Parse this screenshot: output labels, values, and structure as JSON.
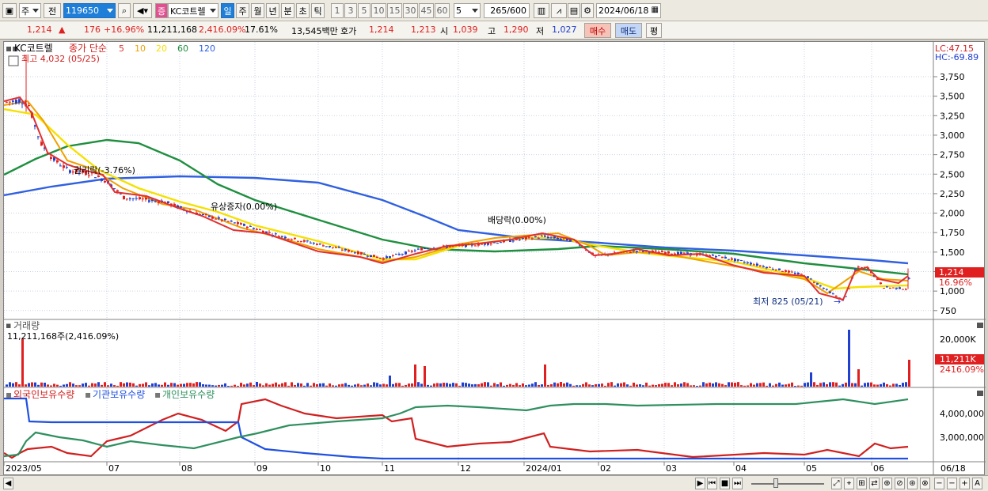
{
  "toolbar": {
    "type_selector": "주",
    "prev_label": "전",
    "code_value": "119650",
    "stock_badge": "증",
    "stock_name": "KC코트렐",
    "period_tabs": [
      "일",
      "주",
      "월",
      "년",
      "분",
      "초",
      "틱"
    ],
    "active_period": "일",
    "interval_buttons": [
      "1",
      "3",
      "5",
      "10",
      "15",
      "30",
      "45",
      "60"
    ],
    "interval_value": "5",
    "count_value": "265",
    "count_max": "/600",
    "date_value": "2024/06/18"
  },
  "quote": {
    "price": "1,214",
    "change": "176",
    "change_pct": "+16.96%",
    "volume": "11,211,168",
    "volume_pct": "2,416.09%",
    "turnover_rate": "17.61%",
    "amount": "13,545백만",
    "ask_label": "호가",
    "ask_price": "1,214",
    "bid_price": "1,213",
    "open_label": "시",
    "open": "1,039",
    "high_label": "고",
    "high": "1,290",
    "low_label": "저",
    "low": "1,027",
    "buy_button": "매수",
    "sell_button": "매도",
    "eval_button": "평"
  },
  "price_panel": {
    "stock_name": "KC코트렐",
    "legend_title": "종가 단순",
    "ma_periods": [
      "5",
      "10",
      "20",
      "60",
      "120"
    ],
    "ma_colors": [
      "#e03030",
      "#f0a000",
      "#f5e000",
      "#1f8f3f",
      "#3060e0"
    ],
    "max_label": "최고 4,032 (05/25)",
    "min_label": "최저 825 (05/21)",
    "lc_label": "LC:47.15",
    "hc_label": "HC:-69.89",
    "current_price": "1,214",
    "current_pct": "16.96%",
    "events": [
      "권리락(-3.76%)",
      "유상증자(0.00%)",
      "배당락(0.00%)"
    ],
    "y_ticks": [
      "3,750",
      "3,500",
      "3,250",
      "3,000",
      "2,750",
      "2,500",
      "2,250",
      "2,000",
      "1,750",
      "1,500",
      "1,250",
      "1,000",
      "750"
    ]
  },
  "volume_panel": {
    "title": "거래량",
    "info": "11,211,168주(2,416.09%)",
    "y_tick": "20,000K",
    "current_vol": "11,211K",
    "current_pct": "2416.09%"
  },
  "holding_panel": {
    "series": [
      "외국인보유수량",
      "기관보유수량",
      "개인보유수량"
    ],
    "series_colors": [
      "#d02020",
      "#2050e0",
      "#2f8f5f"
    ],
    "y_ticks": [
      "4,000,000",
      "3,000,000"
    ]
  },
  "x_axis": [
    "2023/05",
    "07",
    "08",
    "09",
    "10",
    "11",
    "12",
    "2024/01",
    "02",
    "03",
    "04",
    "05",
    "06"
  ],
  "x_axis_end": "06/18",
  "colors": {
    "up": "#e02020",
    "down": "#2040d0"
  }
}
